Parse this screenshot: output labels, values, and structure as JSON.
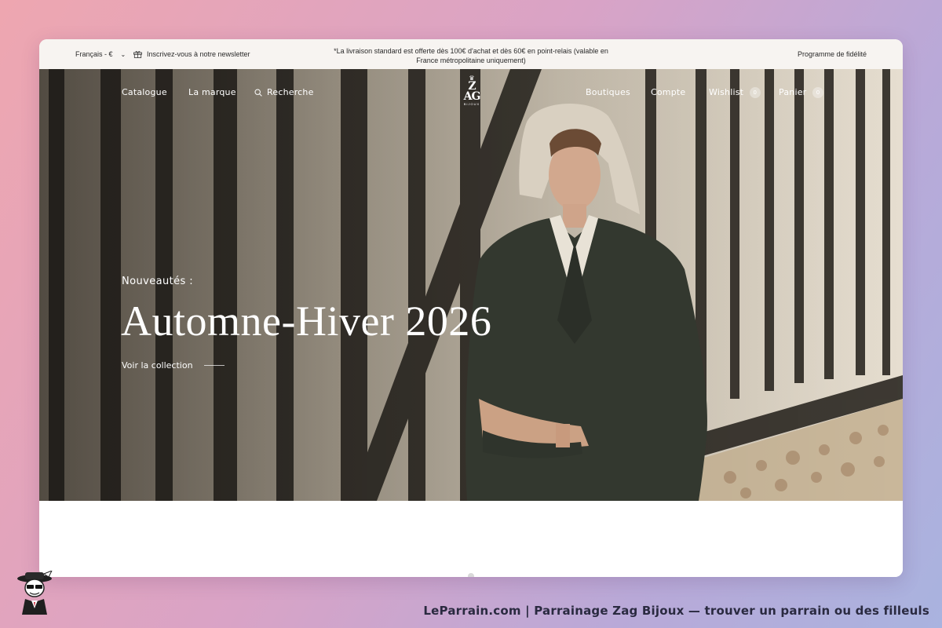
{
  "topbar": {
    "language": "Français - €",
    "newsletter": "Inscrivez-vous à notre newsletter",
    "announcement_line1": "*La livraison standard est offerte dès 100€ d'achat et dès 60€ en point-relais (valable en",
    "announcement_line2": "France métropolitaine uniquement)",
    "loyalty": "Programme de fidélité"
  },
  "nav": {
    "catalogue": "Catalogue",
    "brand": "La marque",
    "search": "Recherche",
    "boutiques": "Boutiques",
    "account": "Compte",
    "wishlist": "Wishlist",
    "wishlist_count": "0",
    "cart": "Panier",
    "cart_count": "0"
  },
  "logo": {
    "mark_top": "Z",
    "mark_bottom": "AG",
    "sub": "BIJOUX"
  },
  "hero": {
    "kicker": "Nouveautés :",
    "title": "Automne-Hiver 2026",
    "cta": "Voir la collection"
  },
  "footer": {
    "caption": "LeParrain.com | Parrainage Zag Bijoux — trouver un parrain ou des filleuls"
  },
  "icons": {
    "gift": "gift-icon",
    "search": "search-icon",
    "chevron": "chevron-down-icon"
  },
  "colors": {
    "background_start": "#eea6b0",
    "background_end": "#a9b3df",
    "topbar": "#f7f4f1",
    "hero_text": "#ffffff",
    "jacket": "#33382f"
  }
}
